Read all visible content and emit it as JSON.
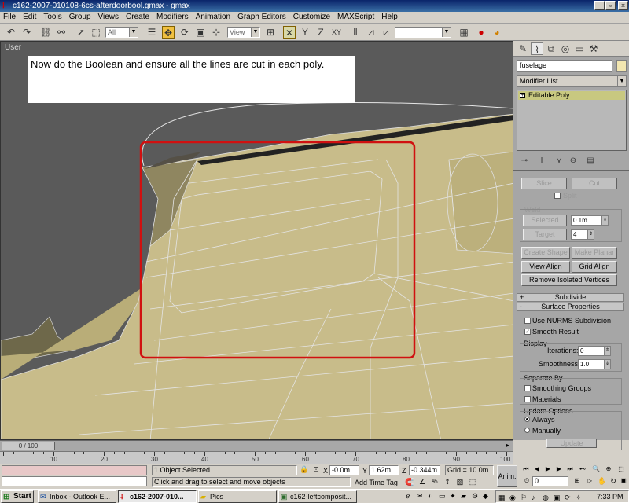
{
  "window": {
    "title": "c162-2007-010108-6cs-afterdoorbool.gmax - gmax",
    "minimize": "_",
    "maximize": "▫",
    "close": "×"
  },
  "menu": [
    "File",
    "Edit",
    "Tools",
    "Group",
    "Views",
    "Create",
    "Modifiers",
    "Animation",
    "Graph Editors",
    "Customize",
    "MAXScript",
    "Help"
  ],
  "toolbar": {
    "selection_filter": "All",
    "ref_coord": "View",
    "named_selection": ""
  },
  "viewport": {
    "label": "User",
    "note": "Now do the Boolean and ensure all the lines are cut in each poly.",
    "highlight_color": "#d01010",
    "surface_color": "#c8bc8a"
  },
  "command_panel": {
    "object_name": "fuselage",
    "object_color": "#f2e6b0",
    "modifier_list": "Modifier List",
    "stack_item": "Editable Poly",
    "buttons": {
      "slice": "Slice",
      "cut": "Cut",
      "split": "Split",
      "weld_label": "Weld",
      "selected": "Selected",
      "target": "Target",
      "create_shape": "Create Shape",
      "make_planar": "Make Planar",
      "view_align": "View Align",
      "grid_align": "Grid Align",
      "remove_isolated": "Remove Isolated Vertices"
    },
    "weld_threshold": "0.1m",
    "target_pixels": "4",
    "pixels_label": "pixels",
    "rollouts": {
      "subdivide": "Subdivide",
      "surface_properties": "Surface Properties",
      "subdivide_sign": "+",
      "surface_sign": "-"
    },
    "surface": {
      "use_nurms": "Use NURMS Subdivision",
      "smooth_result": "Smooth Result",
      "display_label": "Display",
      "iterations_label": "Iterations:",
      "iterations_value": "0",
      "smoothness_label": "Smoothness:",
      "smoothness_value": "1.0",
      "separate_by_label": "Separate By",
      "smoothing_groups": "Smoothing Groups",
      "materials": "Materials",
      "update_options_label": "Update Options",
      "always": "Always",
      "manually": "Manually",
      "update_button": "Update"
    }
  },
  "timeline": {
    "frame": "0 / 100",
    "ticks": [
      "10",
      "20",
      "30",
      "40",
      "50",
      "60",
      "70",
      "80",
      "90",
      "100"
    ]
  },
  "status": {
    "selection": "1 Object Selected",
    "prompt": "Click and drag to select and move objects",
    "x_label": "X",
    "x": "-0.0m",
    "y_label": "Y",
    "y": "1.62m",
    "z_label": "Z",
    "z": "-0.344m",
    "grid": "Grid = 10.0m",
    "add_time_tag": "Add Time Tag",
    "anim": "Anim.",
    "frame_field": "0"
  },
  "taskbar": {
    "start": "Start",
    "tasks": [
      "Inbox - Outlook E...",
      "c162-2007-010...",
      "Pics",
      "c162-leftcomposit..."
    ],
    "clock": "7:33 PM"
  }
}
